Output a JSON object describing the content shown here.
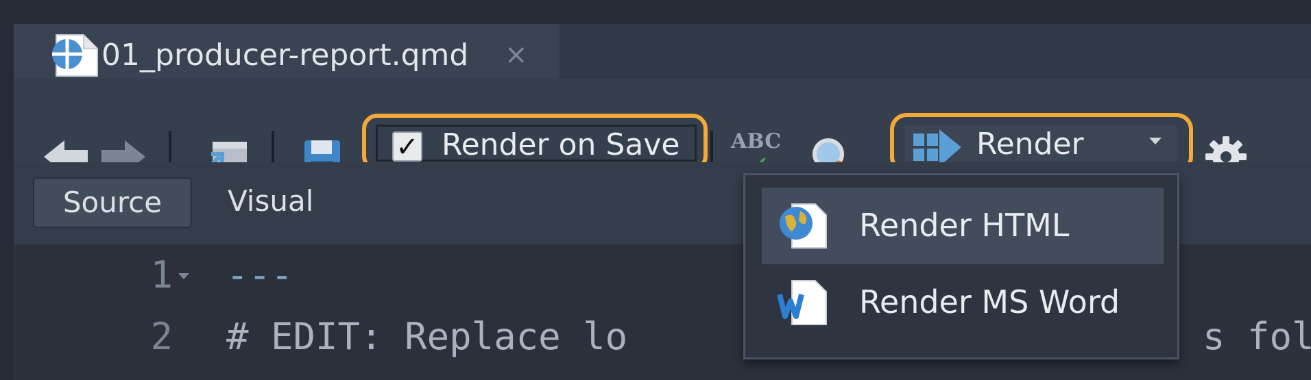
{
  "tab": {
    "filename": "01_producer-report.qmd",
    "close_glyph": "×",
    "file_icon": "quarto-file-icon"
  },
  "toolbar": {
    "back_icon": "arrow-left-icon",
    "forward_icon": "arrow-right-icon",
    "popout_icon": "show-in-new-window-icon",
    "save_icon": "save-icon",
    "render_on_save": {
      "label": "Render on Save",
      "checked": true,
      "check_glyph": "✓"
    },
    "spellcheck_icon": "spellcheck-abc-icon",
    "spellcheck_text": "ABC",
    "spellcheck_check": "✓",
    "search_icon": "magnifier-icon",
    "render_button": {
      "label": "Render",
      "icon": "render-arrow-icon"
    },
    "settings_icon": "gear-icon",
    "highlight_color": "#f4a939"
  },
  "modes": {
    "source": "Source",
    "visual": "Visual",
    "selected": "Source"
  },
  "editor": {
    "lines": [
      {
        "number": "1",
        "text": "---"
      },
      {
        "number": "2",
        "text": "# EDIT: Replace lo"
      },
      {
        "number": "",
        "text": "s fol"
      }
    ]
  },
  "render_menu": {
    "items": [
      {
        "label": "Render HTML",
        "icon": "globe-html-icon",
        "active": true
      },
      {
        "label": "Render MS Word",
        "icon": "word-document-icon",
        "active": false
      }
    ]
  }
}
